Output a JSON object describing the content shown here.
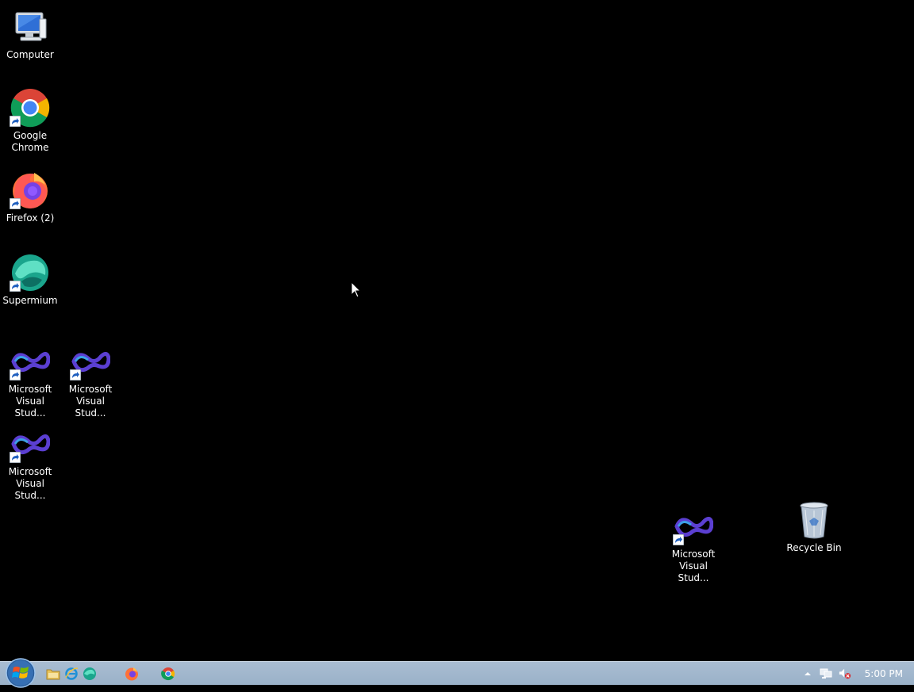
{
  "desktop": {
    "icons": [
      {
        "label": "Computer",
        "icon": "computer-icon"
      },
      {
        "label": "Google Chrome",
        "icon": "chrome-icon"
      },
      {
        "label": "Firefox (2)",
        "icon": "firefox-icon"
      },
      {
        "label": "Supermium",
        "icon": "supermium-icon"
      },
      {
        "label": "Microsoft Visual Stud...",
        "icon": "visual-studio-icon"
      },
      {
        "label": "Microsoft Visual Stud...",
        "icon": "visual-studio-icon"
      },
      {
        "label": "Microsoft Visual Stud...",
        "icon": "visual-studio-icon"
      },
      {
        "label": "Microsoft Visual Stud...",
        "icon": "visual-studio-icon"
      },
      {
        "label": "Recycle Bin",
        "icon": "recycle-bin-icon"
      }
    ]
  },
  "taskbar": {
    "start": {
      "icon": "windows-logo-icon"
    },
    "pinned": [
      {
        "icon": "file-explorer-icon"
      },
      {
        "icon": "internet-explorer-icon"
      },
      {
        "icon": "supermium-icon"
      },
      {
        "icon": "firefox-icon"
      },
      {
        "icon": "chrome-icon"
      }
    ],
    "tray": {
      "icons": [
        "show-hidden-icons-arrow",
        "network-icon",
        "volume-muted-icon"
      ],
      "clock": "5:00 PM"
    }
  },
  "colors": {
    "desktop_bg": "#000000",
    "taskbar_bg": "#a3b8cd"
  }
}
